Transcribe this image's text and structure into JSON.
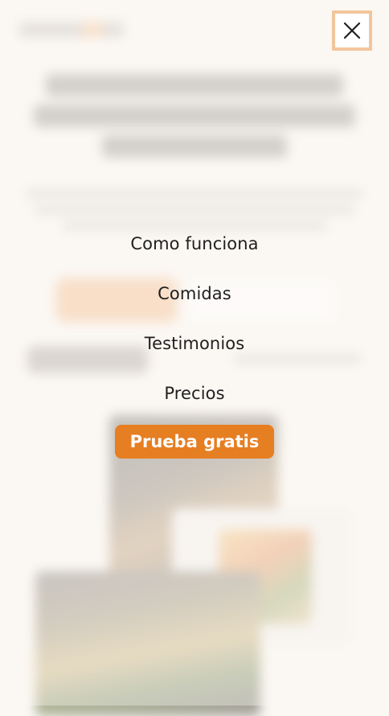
{
  "menu": {
    "close_icon": "close-icon",
    "links": [
      {
        "label": "Como funciona"
      },
      {
        "label": "Comidas"
      },
      {
        "label": "Testimonios"
      },
      {
        "label": "Precios"
      }
    ],
    "cta_label": "Prueba gratis"
  },
  "colors": {
    "accent": "#e67e22",
    "close_border": "#f2c69c",
    "background": "#fbf8f4",
    "text": "#1f1f1f"
  }
}
